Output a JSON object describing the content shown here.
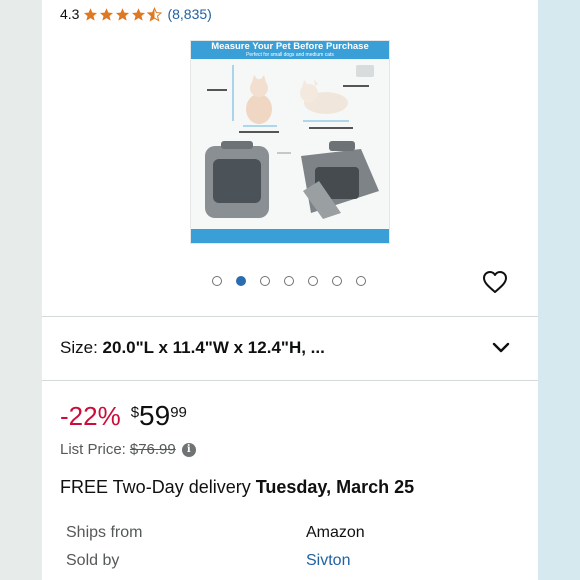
{
  "rating": {
    "value": "4.3",
    "count": "(8,835)",
    "stars_filled": 4.3
  },
  "product_image": {
    "title": "Measure Your Pet Before Purchase",
    "subtitle": "Perfect for small dogs and medium cats"
  },
  "carousel": {
    "total": 7,
    "active_index": 1
  },
  "size": {
    "label": "Size:",
    "value": "20.0\"L x 11.4\"W x 12.4\"H, ..."
  },
  "price": {
    "discount": "-22%",
    "currency": "$",
    "whole": "59",
    "fraction": "99",
    "list_price_label": "List Price:",
    "list_price": "$76.99"
  },
  "delivery": {
    "prefix": "FREE Two-Day delivery",
    "date": "Tuesday, March 25"
  },
  "details": [
    {
      "label": "Ships from",
      "value": "Amazon"
    },
    {
      "label": "Sold by",
      "value": "Sivton"
    }
  ],
  "colors": {
    "accent": "#2162a1",
    "discount": "#cc0c39",
    "star": "#de7921"
  }
}
